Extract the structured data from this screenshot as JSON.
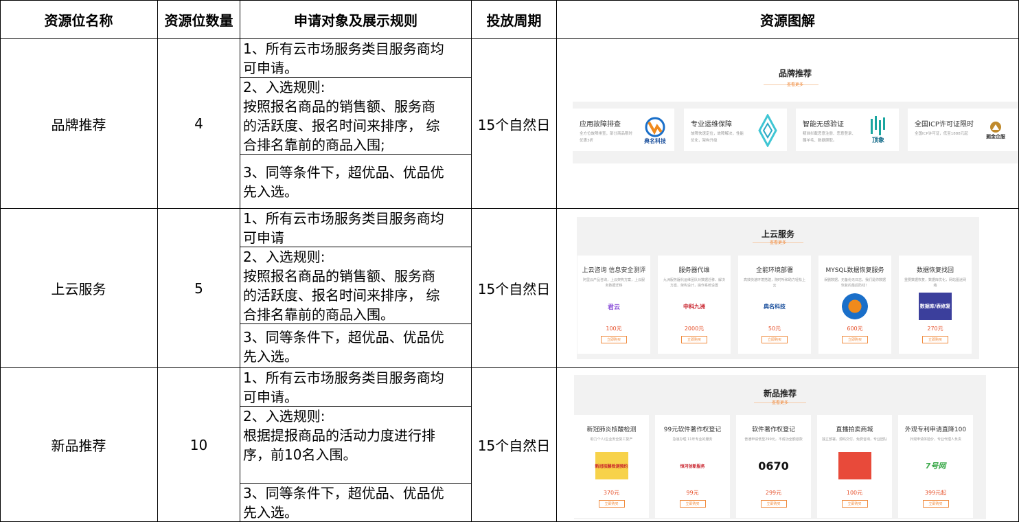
{
  "headers": [
    "资源位名称",
    "资源位数量",
    "申请对象及展示规则",
    "投放周期",
    "资源图解"
  ],
  "rows": [
    {
      "name": "品牌推荐",
      "count": "4",
      "rules": [
        "1、所有云市场服务类目服务商均\n可申请。",
        "2、入选规则:\n按照报名商品的销售额、服务商\n的活跃度、报名时间来排序， 综\n合排名靠前的商品入围;",
        "3、同等条件下，超优品、优品优\n先入选。"
      ],
      "period": "15个自然日"
    },
    {
      "name": "上云服务",
      "count": "5",
      "rules": [
        "1、所有云市场服务类目服务商均\n可申请",
        "2、入选规则:\n按照报名商品的销售额、服务商\n的活跃度、报名时间来排序， 综\n合排名靠前的商品入围。",
        "3、同等条件下，超优品、优品优\n先入选。"
      ],
      "period": "15个自然日"
    },
    {
      "name": "新品推荐",
      "count": "10",
      "rules": [
        "1、所有云市场服务类目服务商均\n可申请。",
        "2、入选规则:\n根据提报商品的活动力度进行排\n序，前10名入围。",
        "3、同等条件下，超优品、优品优\n先入选。"
      ],
      "period": "15个自然日"
    }
  ],
  "brand_panel": {
    "title": "品牌推荐",
    "more": "查看更多",
    "cards": [
      {
        "title": "应用故障排查",
        "desc": "全方位故障排查，部分商品限时优惠3折",
        "logo": "典名科技"
      },
      {
        "title": "专业运维保障",
        "desc": "故障快速定位，故障解决，性能优化，架构升级",
        "logo": ""
      },
      {
        "title": "智能无感验证",
        "desc": "精准拦截恶意注册、恶意登录、薅羊毛、数据爬取。",
        "logo": "顶象"
      },
      {
        "title": "全国ICP许可证限时",
        "desc": "全国ICP许可证，低至1888元起",
        "logo": "掘金企服"
      }
    ]
  },
  "cloud_panel": {
    "title": "上云服务",
    "more": "查看更多",
    "cards": [
      {
        "title": "上云咨询 信息安全测评",
        "desc": "阿里云产品咨询，上云架构方案，上云服务数据迁移",
        "logo": "君云",
        "price": "100元",
        "btn": "立即购买"
      },
      {
        "title": "服务器代维",
        "desc": "九洲服务器代运维团队对数据迁移、解决方案、架构设计，操作系统设置",
        "logo": "中科九洲",
        "price": "2000元",
        "btn": "立即购买"
      },
      {
        "title": "全能环境部署",
        "desc": "高效快速环境搭建，随时听和助力轻松上云",
        "logo": "典名科技",
        "price": "50元",
        "btn": "立即购买"
      },
      {
        "title": "MYSQL数据恢复服务",
        "desc": "误删数据，无备份无日志，我们是你数据恢复的最后防线！",
        "logo": "",
        "price": "600元",
        "btn": "立即购买"
      },
      {
        "title": "数据恢复找回",
        "desc": "重要数据恢复，数据库优化，网站图迷网络",
        "logo": "数据库/表修复",
        "price": "270元",
        "btn": "立即购买"
      }
    ]
  },
  "new_panel": {
    "title": "新品推荐",
    "more": "查看更多",
    "cards": [
      {
        "title": "新冠肺炎核酸检测",
        "desc": "助力个人/企业安全复工复产",
        "logo": "新冠核酸检测预约",
        "price": "370元",
        "btn": "立即购买"
      },
      {
        "title": "99元软件著作权登记",
        "desc": "急速办理 11年专业的服务",
        "logo": "恒河创新服务",
        "price": "99元",
        "btn": "立即购买"
      },
      {
        "title": "软件著作权登记",
        "desc": "普通申请低至299元，不成功全额退款",
        "logo": "0670",
        "price": "299元",
        "btn": "立即购买"
      },
      {
        "title": "直播拍卖商城",
        "desc": "独立部署，源码交付，免费咨询，专业团队",
        "logo": "",
        "price": "100元",
        "btn": "立即购买"
      },
      {
        "title": "外观专利申请直降100",
        "desc": "外观申请体验价，专业代理人负责",
        "logo": "7号网",
        "price": "399元起",
        "btn": "立即购买"
      }
    ]
  }
}
